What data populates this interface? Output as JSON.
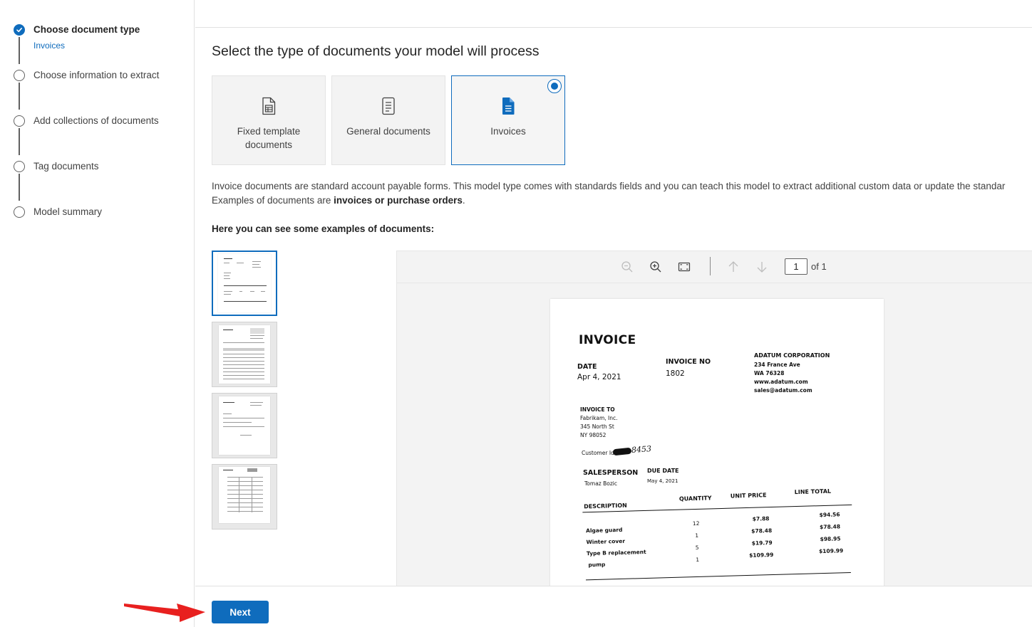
{
  "stepper": {
    "steps": [
      {
        "label": "Choose document type",
        "sub": "Invoices",
        "status": "done"
      },
      {
        "label": "Choose information to extract",
        "status": "pending"
      },
      {
        "label": "Add collections of documents",
        "status": "pending"
      },
      {
        "label": "Tag documents",
        "status": "pending"
      },
      {
        "label": "Model summary",
        "status": "pending"
      }
    ]
  },
  "main": {
    "heading": "Select the type of documents your model will process",
    "tiles": [
      {
        "label": "Fixed template documents",
        "icon": "form-document-icon",
        "selected": false
      },
      {
        "label": "General documents",
        "icon": "text-document-icon",
        "selected": false
      },
      {
        "label": "Invoices",
        "icon": "invoice-document-icon",
        "selected": true
      }
    ],
    "description_line1": "Invoice documents are standard account payable forms. This model type comes with standards fields and you can teach this model to extract additional custom data or update the standar",
    "description_line2_prefix": "Examples of documents are ",
    "description_line2_bold": "invoices or purchase orders",
    "description_line2_suffix": ".",
    "examples_label": "Here you can see some examples of documents:"
  },
  "viewer": {
    "page_value": "1",
    "page_of": "of 1",
    "tools": [
      "zoom-out-icon",
      "zoom-in-icon",
      "fit-page-icon",
      "arrow-up-icon",
      "arrow-down-icon"
    ]
  },
  "document": {
    "title": "INVOICE",
    "date_label": "DATE",
    "date_value": "Apr 4, 2021",
    "invoice_no_label": "INVOICE NO",
    "invoice_no_value": "1802",
    "company": "ADATUM CORPORATION",
    "company_address": [
      "234 France Ave",
      "WA 76328",
      "www.adatum.com",
      "sales@adatum.com"
    ],
    "invoice_to_label": "INVOICE TO",
    "invoice_to": [
      "Fabrikam, Inc.",
      "345 North St",
      "NY 98052"
    ],
    "customer_id_label": "Customer Id:",
    "customer_id_handwritten": "8453",
    "salesperson_label": "SALESPERSON",
    "salesperson_value": "Tomaz Bozic",
    "due_date_label": "DUE DATE",
    "due_date_value": "May 4, 2021",
    "columns": [
      "DESCRIPTION",
      "QUANTITY",
      "UNIT PRICE",
      "LINE TOTAL"
    ],
    "rows": [
      {
        "description": "Algae guard",
        "qty": "12",
        "unit": "$7.88",
        "total": "$94.56"
      },
      {
        "description": "Winter cover",
        "qty": "1",
        "unit": "$78.48",
        "total": "$78.48"
      },
      {
        "description": "Type B replacement",
        "qty": "5",
        "unit": "$19.79",
        "total": "$98.95"
      },
      {
        "description": "pump",
        "qty": "1",
        "unit": "$109.99",
        "total": "$109.99"
      }
    ]
  },
  "footer": {
    "next_label": "Next"
  },
  "colors": {
    "accent": "#0f6cbd",
    "annotation_arrow": "#e8201f"
  }
}
